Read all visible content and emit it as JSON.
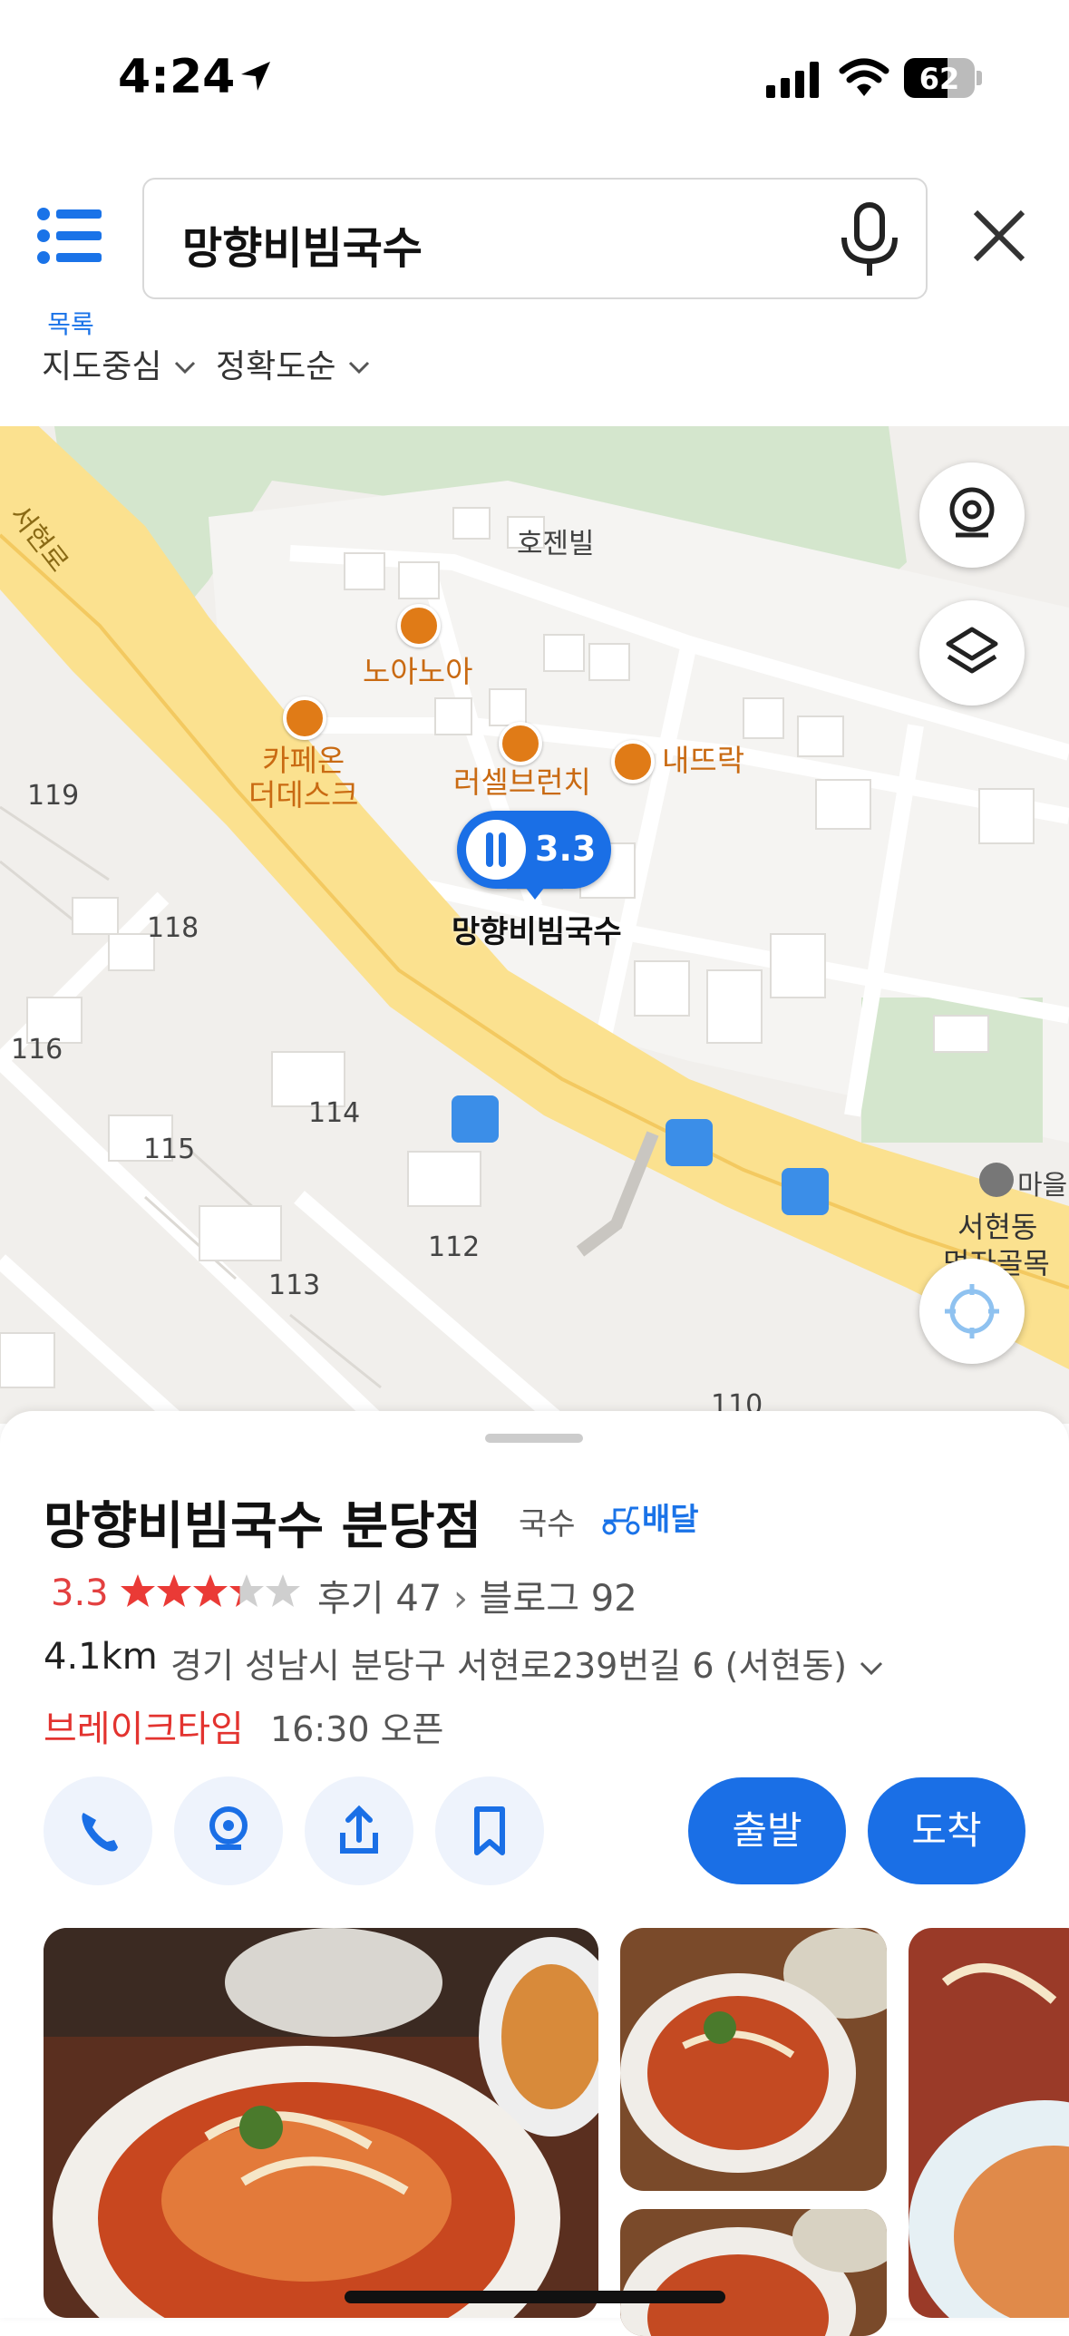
{
  "status_bar": {
    "time": "4:24",
    "battery": "62"
  },
  "header": {
    "list_label": "목록",
    "search_value": "망향비빔국수",
    "filters": [
      {
        "label": "지도중심"
      },
      {
        "label": "정확도순"
      }
    ]
  },
  "map": {
    "road_label": "서현로",
    "building_labels": [
      "호젠빌",
      "119",
      "118",
      "116",
      "115",
      "114",
      "113",
      "112",
      "110"
    ],
    "places": [
      {
        "name": "노아노아",
        "icon": "restaurant-icon"
      },
      {
        "name": "카페온\n더데스크",
        "icon": "cafe-icon"
      },
      {
        "name": "러셀브런치",
        "icon": "bakery-icon"
      },
      {
        "name": "내뜨락",
        "icon": "restaurant-icon"
      }
    ],
    "selected": {
      "name": "망향비빔국수",
      "rating": "3.3"
    },
    "area_labels": [
      "마을",
      "서현동",
      "먹자골목"
    ]
  },
  "place": {
    "name": "망향비빔국수 분당점",
    "category": "국수",
    "delivery": "배달",
    "rating": "3.3",
    "stars": 3.3,
    "reviews_label": "후기 47",
    "blog_label": "블로그 92",
    "distance": "4.1km",
    "address": "경기 성남시 분당구 서현로239번길 6 (서현동)",
    "status": "브레이크타임",
    "open_info": "16:30 오픈",
    "actions": [
      "phone-icon",
      "location-icon",
      "share-icon",
      "bookmark-icon"
    ],
    "depart_label": "출발",
    "arrive_label": "도착"
  },
  "colors": {
    "accent": "#1a73e8",
    "rating": "#e34040",
    "place_label": "#c96a12"
  }
}
